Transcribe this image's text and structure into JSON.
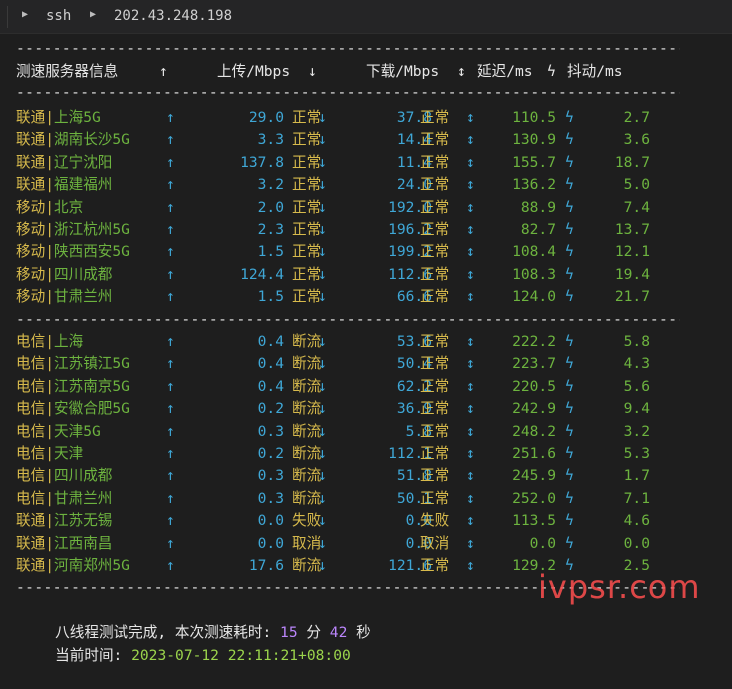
{
  "tabbar": {
    "tab1": "ssh",
    "tab2": "202.43.248.198"
  },
  "header": {
    "col_server": "测速服务器信息",
    "up_arrow": "↑",
    "col_up": "上传/Mbps",
    "down_arrow": "↓",
    "col_down": "下载/Mbps",
    "updown": "↕",
    "col_latency": "延迟/ms",
    "bolt": "ϟ",
    "col_jitter": "抖动/ms"
  },
  "dash": "-----------------------------------------------------------------------------",
  "rows_group1": [
    {
      "isp": "联通",
      "city": "上海5G",
      "up": "29.0",
      "up_status": "正常",
      "down": "37.8",
      "down_status": "正常",
      "latency": "110.5",
      "jitter": "2.7"
    },
    {
      "isp": "联通",
      "city": "湖南长沙5G",
      "up": "3.3",
      "up_status": "正常",
      "down": "14.4",
      "down_status": "正常",
      "latency": "130.9",
      "jitter": "3.6"
    },
    {
      "isp": "联通",
      "city": "辽宁沈阳",
      "up": "137.8",
      "up_status": "正常",
      "down": "11.4",
      "down_status": "正常",
      "latency": "155.7",
      "jitter": "18.7"
    },
    {
      "isp": "联通",
      "city": "福建福州",
      "up": "3.2",
      "up_status": "正常",
      "down": "24.0",
      "down_status": "正常",
      "latency": "136.2",
      "jitter": "5.0"
    },
    {
      "isp": "移动",
      "city": "北京",
      "up": "2.0",
      "up_status": "正常",
      "down": "192.0",
      "down_status": "正常",
      "latency": "88.9",
      "jitter": "7.4"
    },
    {
      "isp": "移动",
      "city": "浙江杭州5G",
      "up": "2.3",
      "up_status": "正常",
      "down": "196.2",
      "down_status": "正常",
      "latency": "82.7",
      "jitter": "13.7"
    },
    {
      "isp": "移动",
      "city": "陕西西安5G",
      "up": "1.5",
      "up_status": "正常",
      "down": "199.2",
      "down_status": "正常",
      "latency": "108.4",
      "jitter": "12.1"
    },
    {
      "isp": "移动",
      "city": "四川成都",
      "up": "124.4",
      "up_status": "正常",
      "down": "112.6",
      "down_status": "正常",
      "latency": "108.3",
      "jitter": "19.4"
    },
    {
      "isp": "移动",
      "city": "甘肃兰州",
      "up": "1.5",
      "up_status": "正常",
      "down": "66.6",
      "down_status": "正常",
      "latency": "124.0",
      "jitter": "21.7"
    }
  ],
  "rows_group2": [
    {
      "isp": "电信",
      "city": "上海",
      "up": "0.4",
      "up_status": "断流",
      "down": "53.6",
      "down_status": "正常",
      "latency": "222.2",
      "jitter": "5.8"
    },
    {
      "isp": "电信",
      "city": "江苏镇江5G",
      "up": "0.4",
      "up_status": "断流",
      "down": "50.4",
      "down_status": "正常",
      "latency": "223.7",
      "jitter": "4.3"
    },
    {
      "isp": "电信",
      "city": "江苏南京5G",
      "up": "0.4",
      "up_status": "断流",
      "down": "62.2",
      "down_status": "正常",
      "latency": "220.5",
      "jitter": "5.6"
    },
    {
      "isp": "电信",
      "city": "安徽合肥5G",
      "up": "0.2",
      "up_status": "断流",
      "down": "36.9",
      "down_status": "正常",
      "latency": "242.9",
      "jitter": "9.4"
    },
    {
      "isp": "电信",
      "city": "天津5G",
      "up": "0.3",
      "up_status": "断流",
      "down": "5.8",
      "down_status": "正常",
      "latency": "248.2",
      "jitter": "3.2"
    },
    {
      "isp": "电信",
      "city": "天津",
      "up": "0.2",
      "up_status": "断流",
      "down": "112.1",
      "down_status": "正常",
      "latency": "251.6",
      "jitter": "5.3"
    },
    {
      "isp": "电信",
      "city": "四川成都",
      "up": "0.3",
      "up_status": "断流",
      "down": "51.8",
      "down_status": "正常",
      "latency": "245.9",
      "jitter": "1.7"
    },
    {
      "isp": "电信",
      "city": "甘肃兰州",
      "up": "0.3",
      "up_status": "断流",
      "down": "50.1",
      "down_status": "正常",
      "latency": "252.0",
      "jitter": "7.1"
    },
    {
      "isp": "联通",
      "city": "江苏无锡",
      "up": "0.0",
      "up_status": "失败",
      "down": "0.0",
      "down_status": "失败",
      "latency": "113.5",
      "jitter": "4.6"
    },
    {
      "isp": "联通",
      "city": "江西南昌",
      "up": "0.0",
      "up_status": "取消",
      "down": "0.0",
      "down_status": "取消",
      "latency": "0.0",
      "jitter": "0.0"
    },
    {
      "isp": "联通",
      "city": "河南郑州5G",
      "up": "17.6",
      "up_status": "断流",
      "down": "121.6",
      "down_status": "正常",
      "latency": "129.2",
      "jitter": "2.5"
    }
  ],
  "summary": {
    "prefix": "八线程测试完成, 本次测速耗时: ",
    "minutes": "15",
    "min_unit": " 分 ",
    "seconds": "42",
    "sec_unit": " 秒",
    "time_label": "当前时间: ",
    "time_value": "2023-07-12 22:11:21+08:00"
  },
  "watermark": "ivpsr.com",
  "colors": {
    "yellow": "#d7ba4c",
    "green": "#6db33f",
    "blue": "#3fa7d6",
    "purple": "#bb86fc",
    "watermark": "#ff4f4f"
  }
}
